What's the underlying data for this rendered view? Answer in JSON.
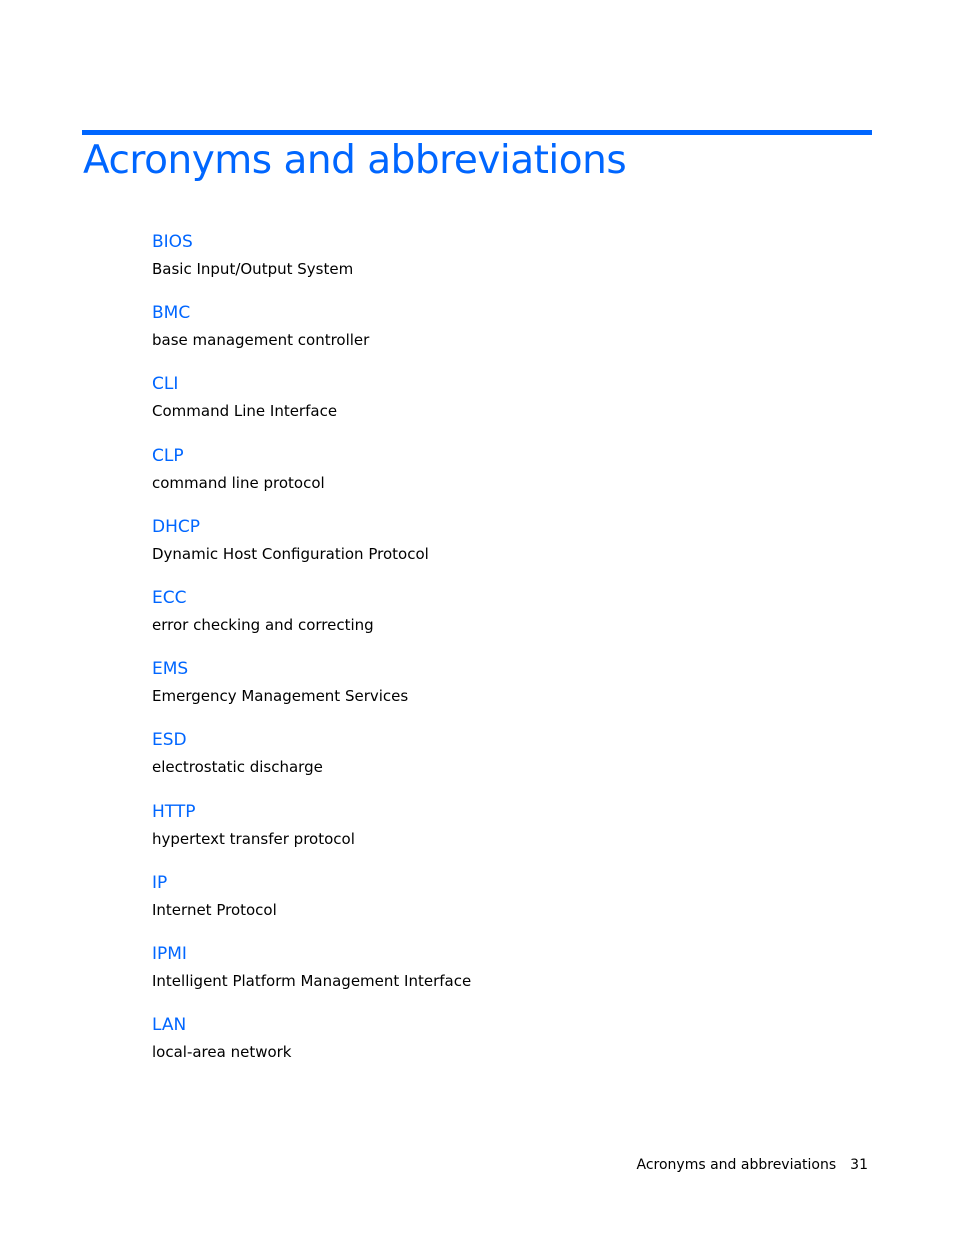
{
  "page": {
    "title": "Acronyms and abbreviations",
    "accent_color": "#0066ff",
    "entries": [
      {
        "term": "BIOS",
        "definition": "Basic Input/Output System"
      },
      {
        "term": "BMC",
        "definition": "base management controller"
      },
      {
        "term": "CLI",
        "definition": "Command Line Interface"
      },
      {
        "term": "CLP",
        "definition": "command line protocol"
      },
      {
        "term": "DHCP",
        "definition": "Dynamic Host Configuration Protocol"
      },
      {
        "term": "ECC",
        "definition": "error checking and correcting"
      },
      {
        "term": "EMS",
        "definition": "Emergency Management Services"
      },
      {
        "term": "ESD",
        "definition": "electrostatic discharge"
      },
      {
        "term": "HTTP",
        "definition": "hypertext transfer protocol"
      },
      {
        "term": "IP",
        "definition": "Internet Protocol"
      },
      {
        "term": "IPMI",
        "definition": "Intelligent Platform Management Interface"
      },
      {
        "term": "LAN",
        "definition": "local-area network"
      }
    ]
  },
  "footer": {
    "section": "Acronyms and abbreviations",
    "page_number": "31"
  }
}
